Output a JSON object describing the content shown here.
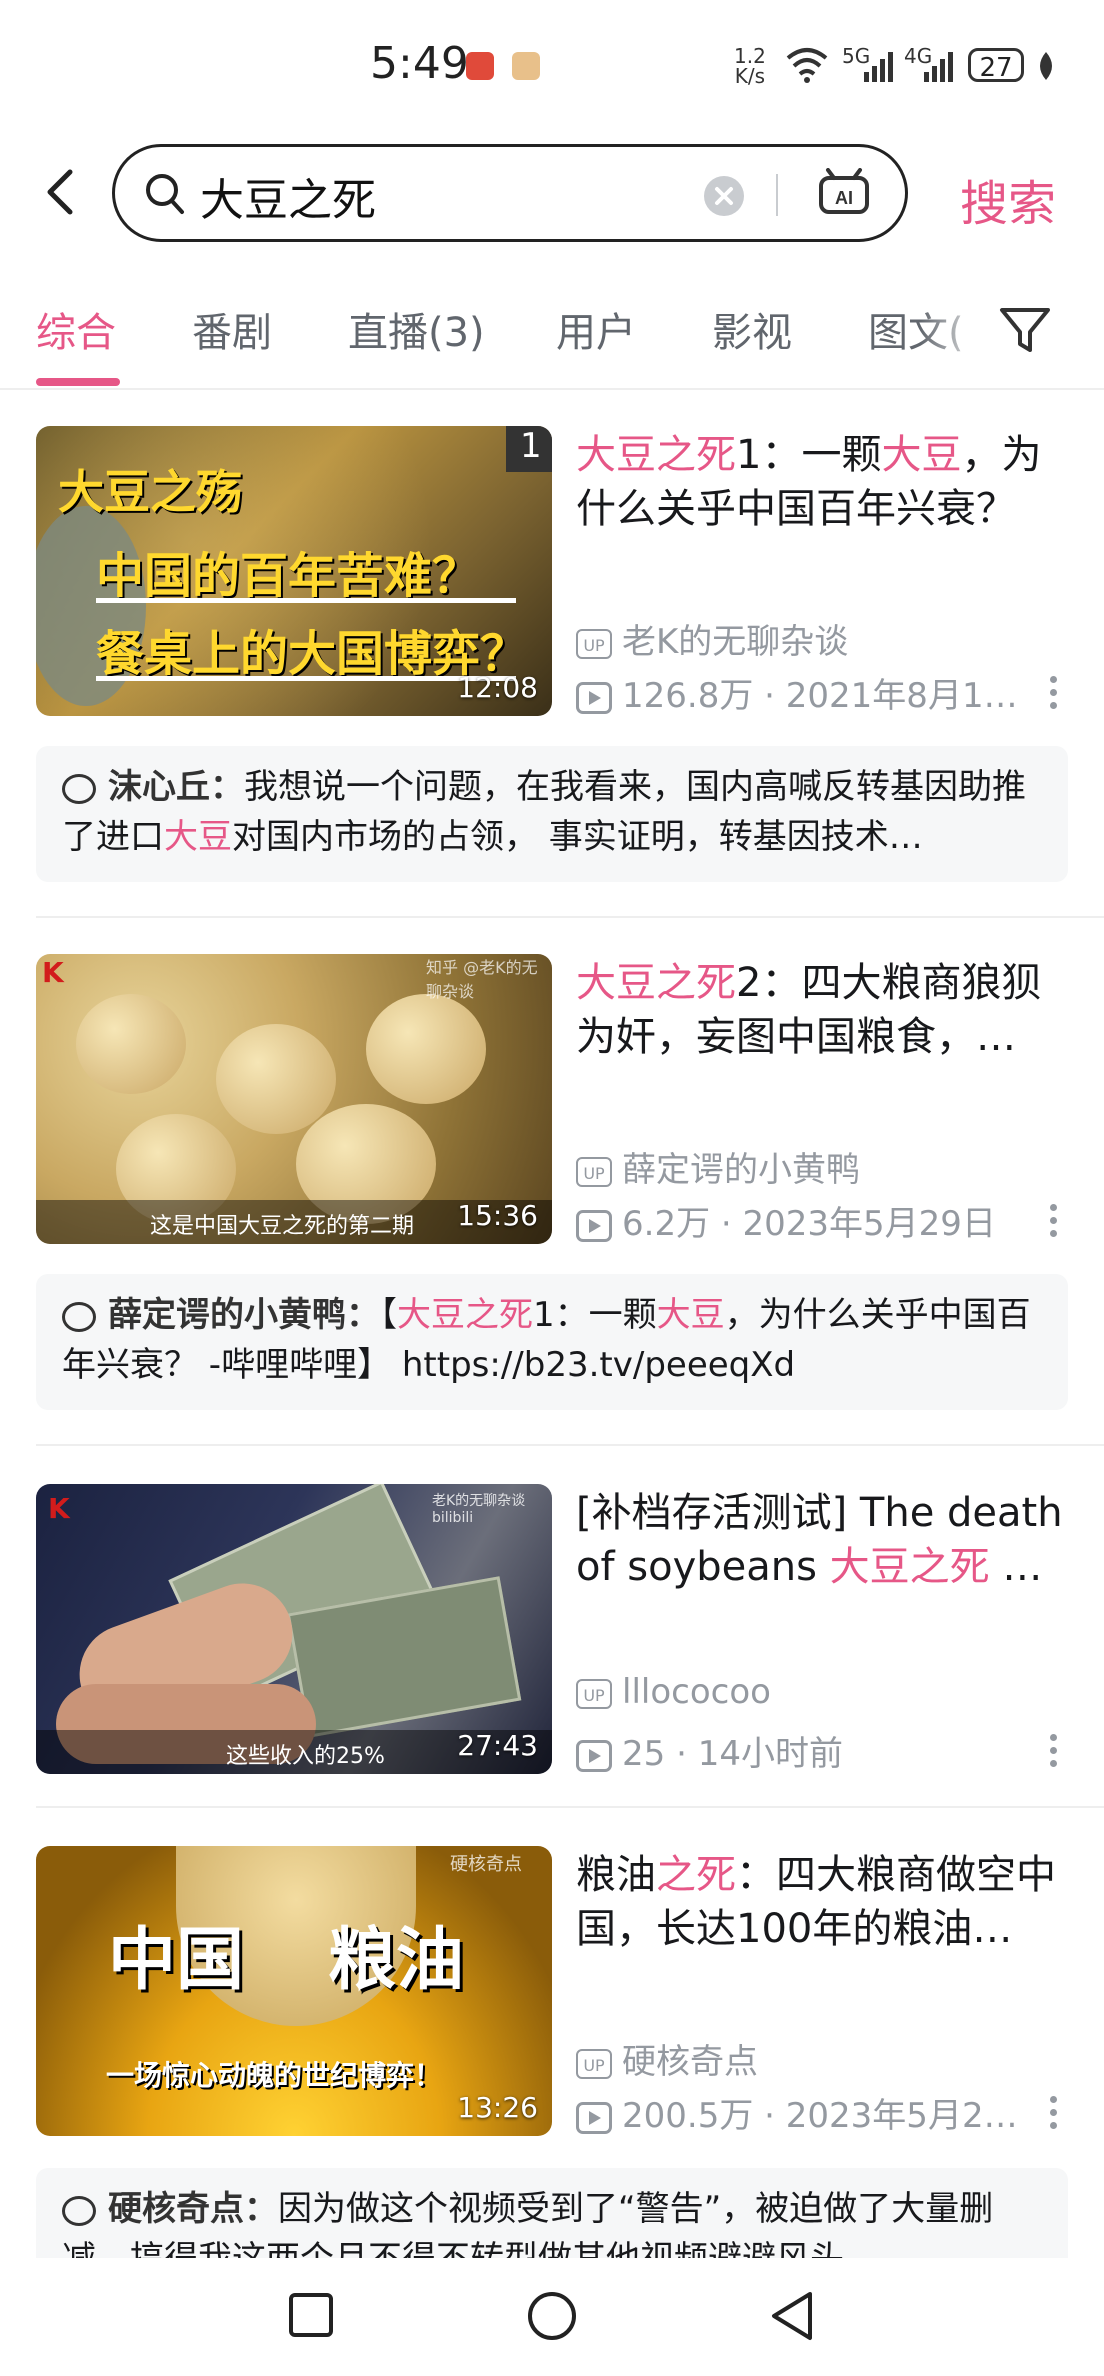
{
  "status_bar": {
    "time": "5:49",
    "net_speed_value": "1.2",
    "net_speed_unit": "K/s",
    "signal_1": "5G",
    "signal_2": "4G",
    "battery": "27"
  },
  "search": {
    "query": "大豆之死",
    "button_label": "搜索"
  },
  "tabs": [
    {
      "label": "综合",
      "active": true
    },
    {
      "label": "番剧"
    },
    {
      "label": "直播(3)"
    },
    {
      "label": "用户"
    },
    {
      "label": "影视"
    },
    {
      "label": "图文("
    }
  ],
  "results": [
    {
      "title_parts": [
        {
          "text": "大豆之死",
          "hl": true
        },
        {
          "text": "1：一颗",
          "hl": false
        },
        {
          "text": "大豆",
          "hl": true
        },
        {
          "text": "，为什么关乎中国百年兴衰？",
          "hl": false
        }
      ],
      "thumb_corner": "1",
      "thumb_line1": "大豆之殇",
      "thumb_line2": "中国的百年苦难？",
      "thumb_line3": "餐桌上的大国博弈？",
      "duration": "12:08",
      "uploader": "老K的无聊杂谈",
      "views": "126.8万",
      "date": "2021年8月1…",
      "comment_author": "沫心丘：",
      "comment_parts": [
        {
          "text": "我想说一个问题，在我看来，国内高喊反转基因助推了进口",
          "hl": false
        },
        {
          "text": "大豆",
          "hl": true
        },
        {
          "text": "对国内市场的占领， 事实证明，转基因技术…",
          "hl": false
        }
      ]
    },
    {
      "title_parts": [
        {
          "text": "大豆之死",
          "hl": true
        },
        {
          "text": "2：四大粮商狼狈为奸，妄图中国粮食，…",
          "hl": false
        }
      ],
      "thumb_caption": "这是中国大豆之死的第二期",
      "thumb_watermark": "知乎 @老K的无聊杂谈",
      "duration": "15:36",
      "uploader": "薛定谔的小黄鸭",
      "views": "6.2万",
      "date": "2023年5月29日",
      "comment_author": "薛定谔的小黄鸭：",
      "comment_parts": [
        {
          "text": "【",
          "hl": false
        },
        {
          "text": "大豆之死",
          "hl": true
        },
        {
          "text": "1：一颗",
          "hl": false
        },
        {
          "text": "大豆",
          "hl": true
        },
        {
          "text": "，为什么关乎中国百年兴衰？ -哔哩哔哩】 https://b23.tv/peeeqXd",
          "hl": false
        }
      ]
    },
    {
      "title_parts": [
        {
          "text": "[补档存活测试] The death of soybeans ",
          "hl": false
        },
        {
          "text": "大豆之死",
          "hl": true
        },
        {
          "text": " …",
          "hl": false
        }
      ],
      "thumb_caption": "这些收入的25%",
      "thumb_watermark": "老K的无聊杂谈 bilibili",
      "duration": "27:43",
      "uploader": "lllococoo",
      "views": "25",
      "date": "14小时前"
    },
    {
      "title_parts": [
        {
          "text": "粮油",
          "hl": false
        },
        {
          "text": "之死",
          "hl": true
        },
        {
          "text": "：四大粮商做空中国，长达100年的粮油…",
          "hl": false
        }
      ],
      "thumb_big_left": "中国",
      "thumb_big_right": "粮油",
      "thumb_caption": "一场惊心动魄的世纪博弈！",
      "thumb_watermark": "硬核奇点",
      "duration": "13:26",
      "uploader": "硬核奇点",
      "views": "200.5万",
      "date": "2023年5月2…",
      "comment_author": "硬核奇点：",
      "comment_parts": [
        {
          "text": "因为做这个视频受到了“警告”，被迫做了大量删减，搞得我这两个月不得不转型做其他视频避避风头",
          "hl": false
        }
      ]
    }
  ],
  "colors": {
    "accent": "#e65787",
    "secondary_text": "#9499a0",
    "comment_bg": "#f6f7f8"
  },
  "icons": [
    "back-icon",
    "search-icon",
    "clear-icon",
    "ai-icon",
    "filter-icon",
    "up-badge-icon",
    "play-count-icon",
    "more-icon",
    "comment-icon",
    "nav-recent-icon",
    "nav-home-icon",
    "nav-back-icon"
  ]
}
